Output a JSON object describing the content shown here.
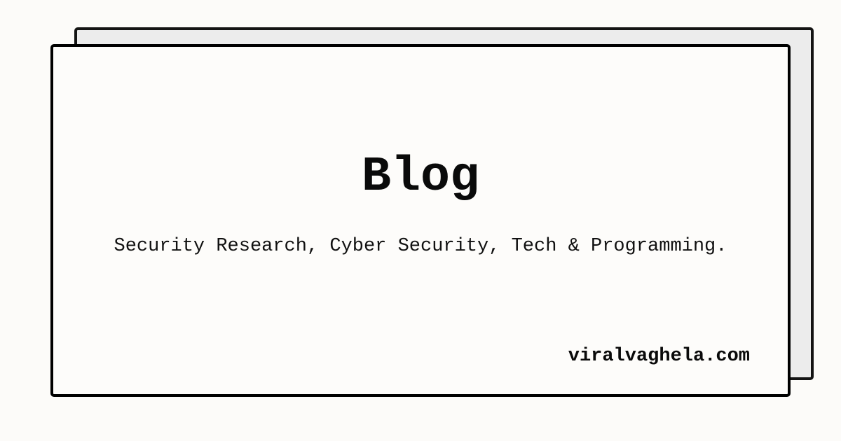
{
  "title": "Blog",
  "subtitle": "Security Research, Cyber Security, Tech & Programming.",
  "domain": "viralvaghela.com",
  "colors": {
    "background": "#fcfbf9",
    "back_card": "#ececec",
    "border": "#000000"
  }
}
